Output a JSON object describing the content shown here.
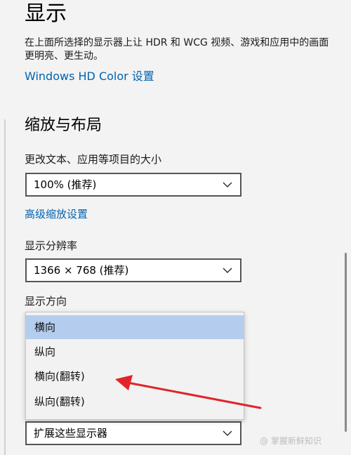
{
  "header": {
    "title": "显示",
    "description": "在上面所选择的显示器上让 HDR 和 WCG 视频、游戏和应用中的画面更明亮、更生动。",
    "hd_color_link": "Windows HD Color 设置"
  },
  "scale_layout": {
    "section_title": "缩放与布局",
    "text_size_label": "更改文本、应用等项目的大小",
    "text_size_value": "100% (推荐)",
    "advanced_scaling_link": "高级缩放设置",
    "resolution_label": "显示分辨率",
    "resolution_value": "1366 × 768 (推荐)",
    "orientation_label": "显示方向",
    "orientation_options": [
      "横向",
      "纵向",
      "横向(翻转)",
      "纵向(翻转)"
    ],
    "orientation_selected": "横向",
    "multi_display_value": "扩展这些显示器"
  },
  "annotation": {
    "arrow_color": "#e0242a"
  },
  "watermark": "@ 掌握新鲜知识",
  "colors": {
    "link": "#0063b1",
    "selected_option": "#b4cdef"
  },
  "icons": [
    "chevron-down-icon"
  ]
}
